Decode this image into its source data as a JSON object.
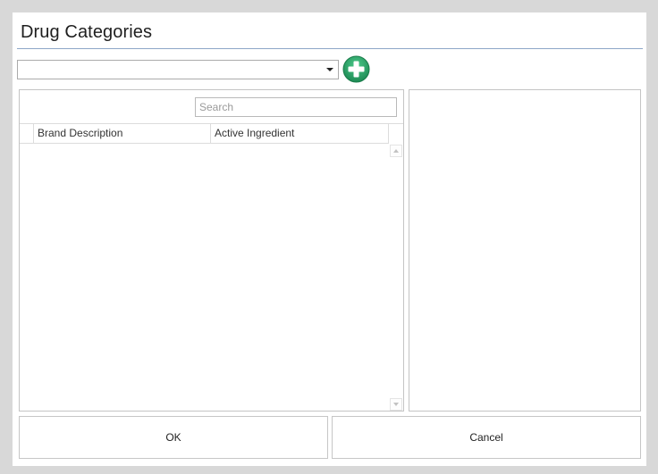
{
  "window": {
    "title": "Drug Categories"
  },
  "category_select": {
    "value": ""
  },
  "add_button": {
    "icon": "plus-circle-icon",
    "color": "#27a065"
  },
  "search": {
    "placeholder": "Search",
    "value": ""
  },
  "grid": {
    "columns": [
      {
        "label": "Brand Description"
      },
      {
        "label": "Active Ingredient"
      }
    ],
    "rows": []
  },
  "footer": {
    "ok_label": "OK",
    "cancel_label": "Cancel"
  },
  "colors": {
    "title_rule": "#8ea7c8",
    "backdrop": "#d8d8d8"
  }
}
